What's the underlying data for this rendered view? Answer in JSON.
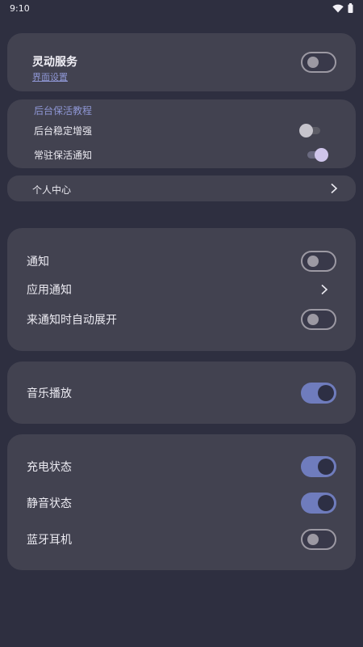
{
  "status_bar": {
    "time": "9:10"
  },
  "service_card": {
    "title": "灵动服务",
    "link": "界面设置",
    "toggle_on": false
  },
  "keepalive_card": {
    "section_title": "后台保活教程",
    "items": [
      {
        "label": "后台稳定增强",
        "on": false
      },
      {
        "label": "常驻保活通知",
        "on": true
      }
    ]
  },
  "personal_center": {
    "label": "个人中心"
  },
  "notify_card": {
    "items": [
      {
        "label": "通知",
        "type": "switch",
        "on": false
      },
      {
        "label": "应用通知",
        "type": "chevron"
      },
      {
        "label": "来通知时自动展开",
        "type": "switch",
        "on": false
      }
    ]
  },
  "music_card": {
    "items": [
      {
        "label": "音乐播放",
        "on": true
      }
    ]
  },
  "status_card": {
    "items": [
      {
        "label": "充电状态",
        "on": true
      },
      {
        "label": "静音状态",
        "on": true
      },
      {
        "label": "蓝牙耳机",
        "on": false
      }
    ]
  },
  "colors": {
    "background": "#2e2f40",
    "card": "#424250",
    "accent": "#6f7cbd",
    "link": "#8e96d4"
  }
}
